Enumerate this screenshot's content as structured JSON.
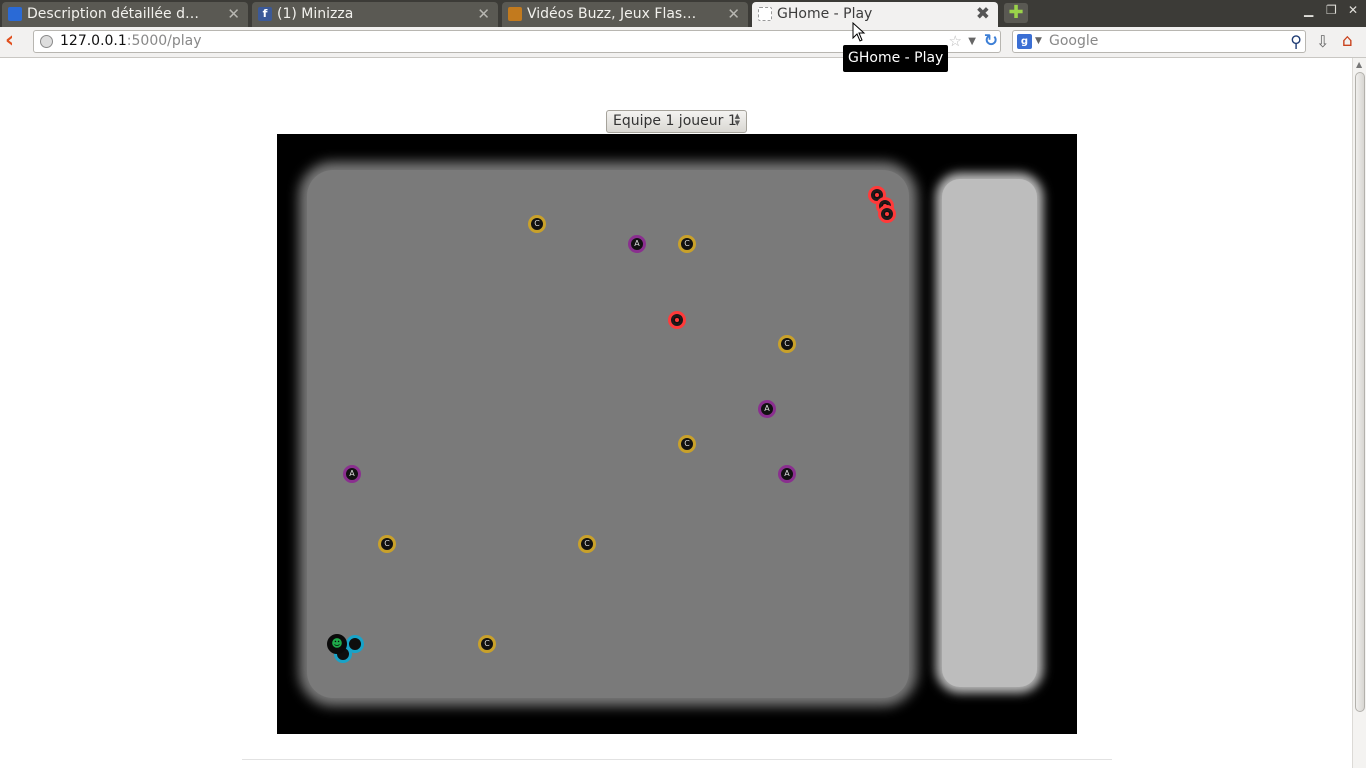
{
  "browser": {
    "tabs": [
      {
        "title": "Description détaillée des ét…",
        "favicon_color": "#2a6ad6",
        "active": false
      },
      {
        "title": "(1) Minizza",
        "favicon_color": "#3b5998",
        "active": false
      },
      {
        "title": "Vidéos Buzz, Jeux Flash et I…",
        "favicon_color": "#c27a1e",
        "active": false
      },
      {
        "title": "GHome - Play",
        "favicon_color": "#ffffff",
        "active": true
      }
    ],
    "new_tab_icon": "plus-icon",
    "url_host": "127.0.0.1",
    "url_path": ":5000/play",
    "search_placeholder": "Google",
    "tooltip": "GHome - Play"
  },
  "page": {
    "player_select_value": "Equipe 1 joueur 1"
  },
  "game": {
    "colors": {
      "board": "#000000",
      "field": "#7a7a7a",
      "side_panel": "#bdbdbd",
      "coin_ring": "#c9a12a",
      "a_ring": "#8a2f8f",
      "red_team": "#ff3a3a",
      "blue_team": "#19a3c8"
    },
    "coin_label": "C",
    "a_label": "A",
    "player_label": "☻"
  }
}
